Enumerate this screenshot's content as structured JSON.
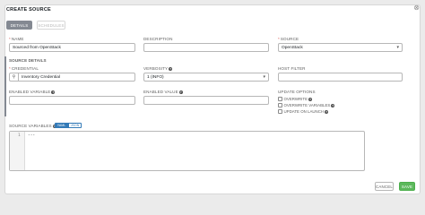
{
  "dialog": {
    "title": "CREATE SOURCE"
  },
  "tabs": [
    {
      "label": "DETAILS"
    },
    {
      "label": "SCHEDULES"
    }
  ],
  "fields": {
    "name": {
      "label": "NAME",
      "value": "Sourced from OpenStack"
    },
    "description": {
      "label": "DESCRIPTION",
      "value": ""
    },
    "source": {
      "label": "SOURCE",
      "value": "OpenStack"
    }
  },
  "source_details": {
    "title": "SOURCE DETAILS",
    "credential": {
      "label": "CREDENTIAL",
      "value": "Inventory Credential"
    },
    "verbosity": {
      "label": "VERBOSITY",
      "value": "1 (INFO)"
    },
    "host_filter": {
      "label": "HOST FILTER",
      "value": ""
    },
    "enabled_variable": {
      "label": "ENABLED VARIABLE",
      "value": ""
    },
    "enabled_value": {
      "label": "ENABLED VALUE",
      "value": ""
    },
    "update_options": {
      "label": "UPDATE OPTIONS",
      "items": [
        "OVERWRITE",
        "OVERWRITE VARIABLES",
        "UPDATE ON LAUNCH"
      ]
    }
  },
  "source_variables": {
    "label": "SOURCE VARIABLES",
    "toggle": [
      "YAML",
      "JSON"
    ],
    "line_number": "1",
    "code": "---"
  },
  "actions": {
    "cancel": "CANCEL",
    "save": "SAVE"
  },
  "colors": {
    "save": "#5cb85c",
    "toggle_active": "#337ab7",
    "tab_active": "#848992",
    "required": "#d9534f"
  }
}
